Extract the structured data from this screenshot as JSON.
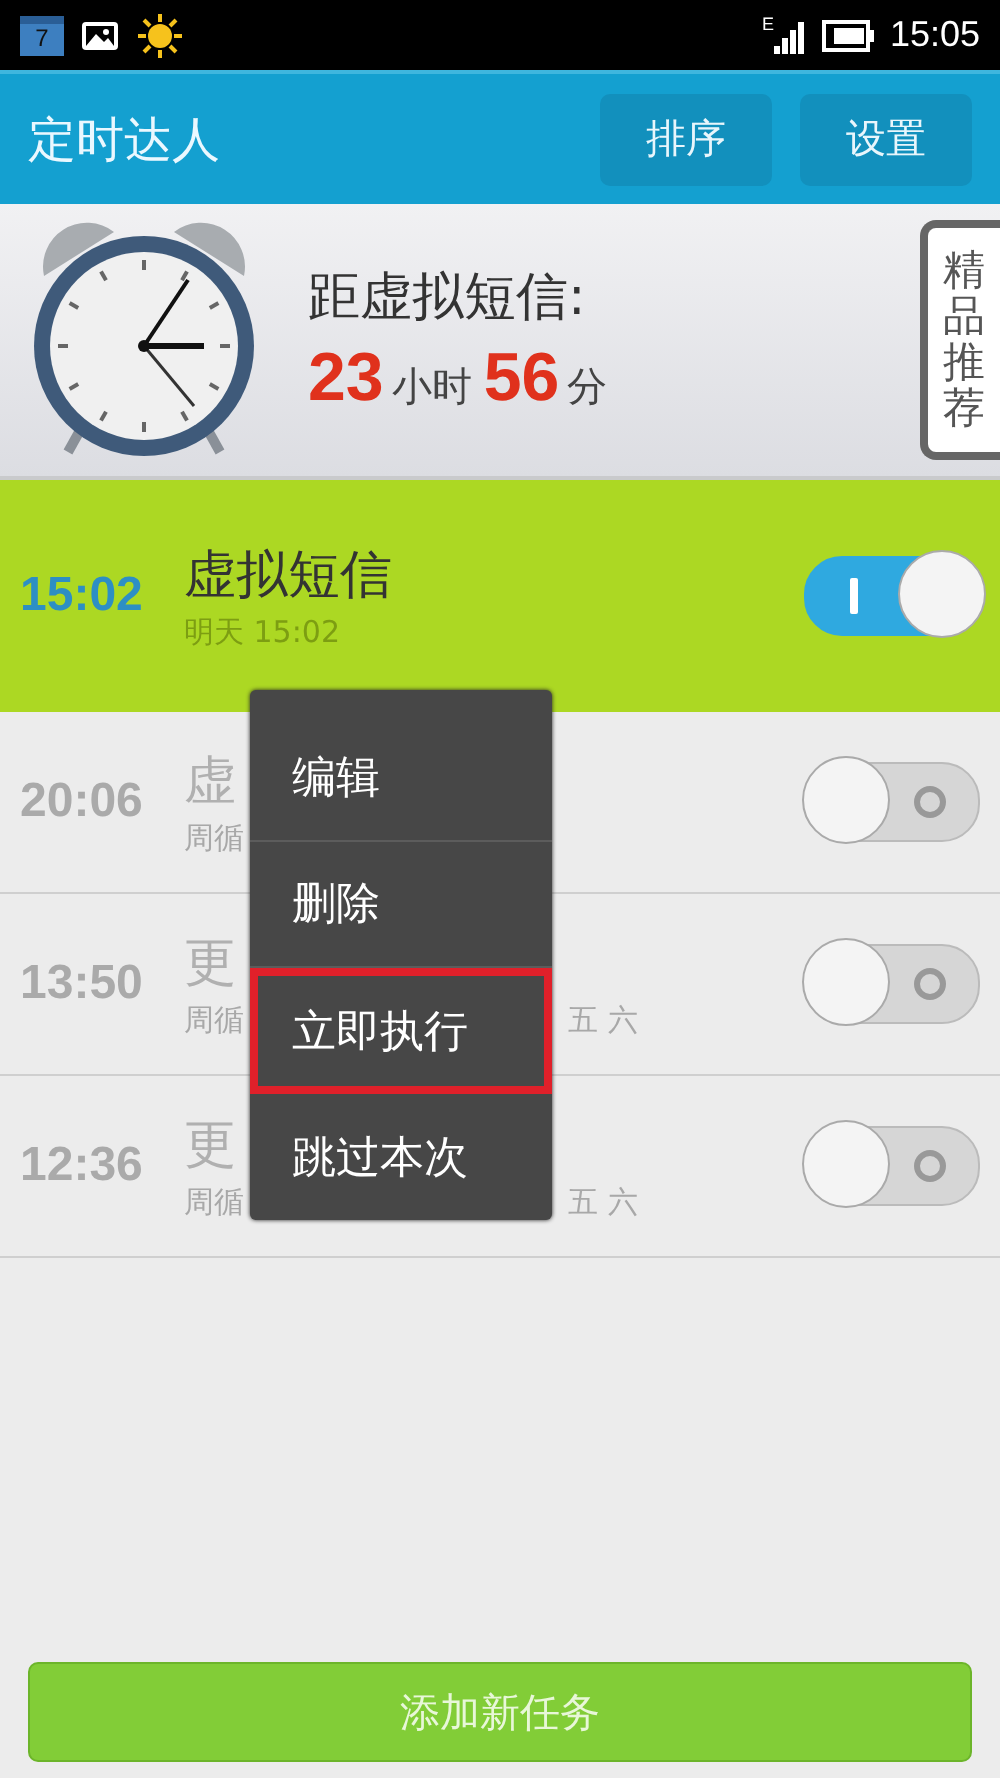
{
  "status_bar": {
    "calendar_day": "7",
    "network": "E",
    "time": "15:05"
  },
  "app_bar": {
    "title": "定时达人",
    "buttons": [
      "排序",
      "设置"
    ]
  },
  "countdown": {
    "label": "距虚拟短信:",
    "hours": "23",
    "hours_unit": "小时",
    "minutes": "56",
    "minutes_unit": "分",
    "side_tab": "精品推荐"
  },
  "tasks": [
    {
      "time": "15:02",
      "title": "虚拟短信",
      "subtitle": "明天 15:02",
      "on": true,
      "selected": true
    },
    {
      "time": "20:06",
      "title": "虚",
      "subtitle": "周循",
      "on": false,
      "selected": false
    },
    {
      "time": "13:50",
      "title": "更",
      "subtitle": "周循",
      "subtitle_tail": "五 六",
      "on": false,
      "selected": false
    },
    {
      "time": "12:36",
      "title": "更",
      "subtitle": "周循",
      "subtitle_tail": "五 六",
      "on": false,
      "selected": false
    }
  ],
  "context_menu": [
    {
      "label": "编辑",
      "highlighted": false
    },
    {
      "label": "删除",
      "highlighted": false
    },
    {
      "label": "立即执行",
      "highlighted": true
    },
    {
      "label": "跳过本次",
      "highlighted": false
    }
  ],
  "add_button": "添加新任务"
}
